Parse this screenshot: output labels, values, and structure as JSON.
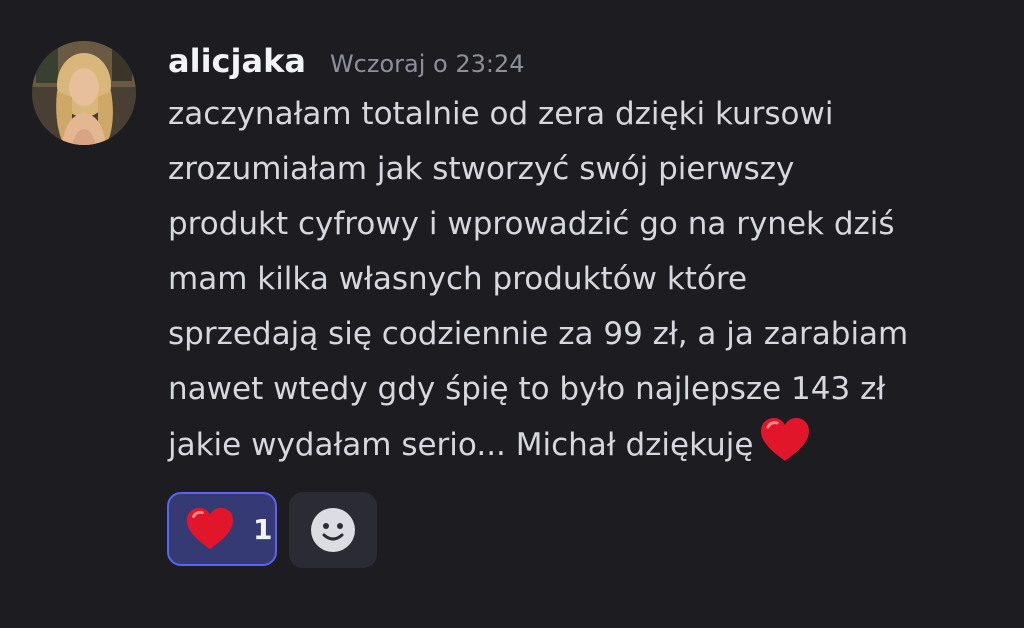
{
  "message": {
    "author": "alicjaka",
    "timestamp": "Wczoraj o 23:24",
    "avatar_icon": "user-avatar-photo",
    "lines": [
      "zaczynałam totalnie od zera dzięki kursowi",
      "zrozumiałam jak stworzyć swój pierwszy",
      "produkt cyfrowy i wprowadzić go na rynek dziś",
      "mam kilka własnych produktów które",
      "sprzedają się codziennie za 99 zł, a ja zarabiam",
      "nawet wtedy gdy śpię to było najlepsze 143 zł",
      "jakie wydałam serio... Michał dziękuję"
    ],
    "trailing_emoji": "red-heart-emoji"
  },
  "reactions": [
    {
      "emoji": "red-heart-emoji",
      "count": "1",
      "selected": true
    }
  ],
  "add_reaction_icon": "smiley-face-icon",
  "colors": {
    "background": "#1c1c21",
    "username": "#f2f3f5",
    "timestamp": "#8e9099",
    "text": "#d7d8dd",
    "reaction_bg": "#353a74",
    "reaction_border": "#5865f2",
    "heart": "#e1162b"
  }
}
